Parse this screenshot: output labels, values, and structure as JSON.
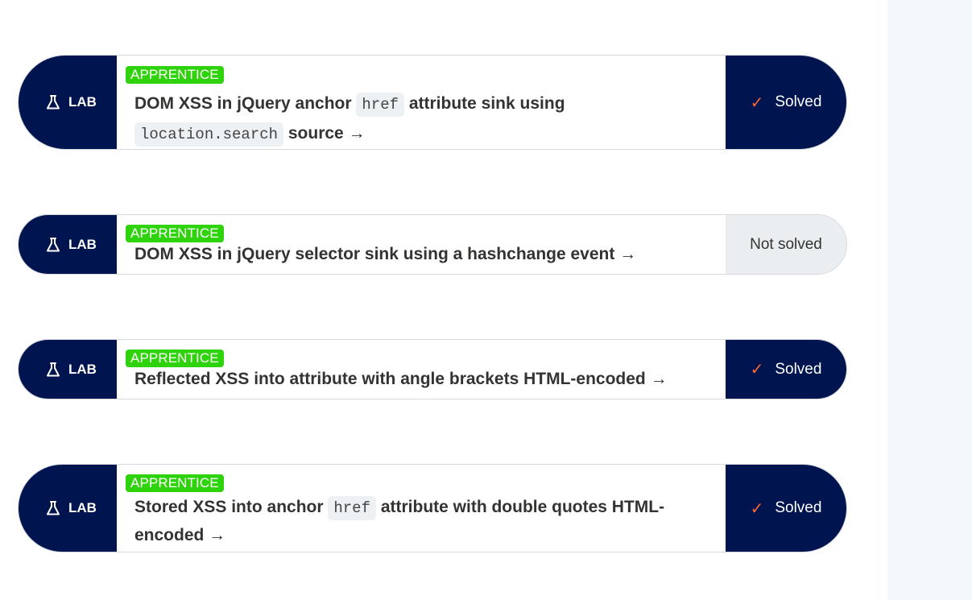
{
  "labs": [
    {
      "type_label": "LAB",
      "level": "APPRENTICE",
      "title_parts": [
        "DOM XSS in jQuery anchor ",
        "href",
        " attribute sink using ",
        "location.search",
        " source →"
      ],
      "status": "Solved",
      "solved": true
    },
    {
      "type_label": "LAB",
      "level": "APPRENTICE",
      "title_parts": [
        "DOM XSS in jQuery selector sink using a hashchange event →"
      ],
      "status": "Not solved",
      "solved": false
    },
    {
      "type_label": "LAB",
      "level": "APPRENTICE",
      "title_parts": [
        "Reflected XSS into attribute with angle brackets HTML-encoded →"
      ],
      "status": "Solved",
      "solved": true
    },
    {
      "type_label": "LAB",
      "level": "APPRENTICE",
      "title_parts": [
        "Stored XSS into anchor ",
        "href",
        " attribute with double quotes HTML-encoded →"
      ],
      "status": "Solved",
      "solved": true
    }
  ],
  "icons": {
    "lab": "flask-icon",
    "solved": "checkmark-icon"
  },
  "colors": {
    "navy": "#00144f",
    "apprentice_green": "#2fd30b",
    "check_orange": "#ff6633",
    "unsolved_bg": "#eaeef1",
    "side_panel": "#f3f9fb"
  }
}
